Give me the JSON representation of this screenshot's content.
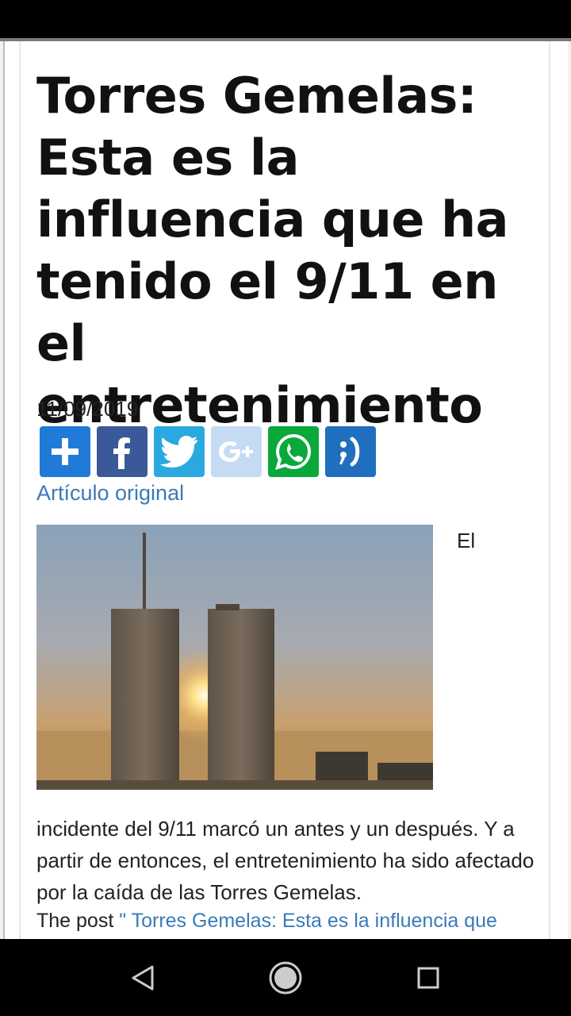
{
  "article": {
    "headline": "Torres Gemelas: Esta es la influencia que ha tenido el 9/11 en el entretenimiento",
    "date": "11/09/2019",
    "original_link": "Artículo original",
    "float_word": "El",
    "body": "incidente del 9/11 marcó un antes y un después. Y a partir de entonces, el entretenimiento ha sido afectado por la caída de las Torres Gemelas.",
    "post_prefix": "The post ",
    "post_link": "\" Torres Gemelas: Esta es la influencia que"
  },
  "share": {
    "buttons": [
      {
        "name": "share-add",
        "icon": "plus-icon",
        "color": "#1f7bd7"
      },
      {
        "name": "share-facebook",
        "icon": "facebook-icon",
        "color": "#3b5998"
      },
      {
        "name": "share-twitter",
        "icon": "twitter-icon",
        "color": "#2aa9e0"
      },
      {
        "name": "share-google-plus",
        "icon": "google-plus-icon",
        "color": "#c5dbf3"
      },
      {
        "name": "share-whatsapp",
        "icon": "whatsapp-icon",
        "color": "#0aa83a"
      },
      {
        "name": "share-meneame",
        "icon": "meneame-icon",
        "color": "#1f6fbe"
      }
    ]
  },
  "navigation": {
    "buttons": [
      "back-icon",
      "home-icon",
      "recents-icon"
    ]
  },
  "colors": {
    "link": "#3a7ab8",
    "text": "#111111"
  }
}
